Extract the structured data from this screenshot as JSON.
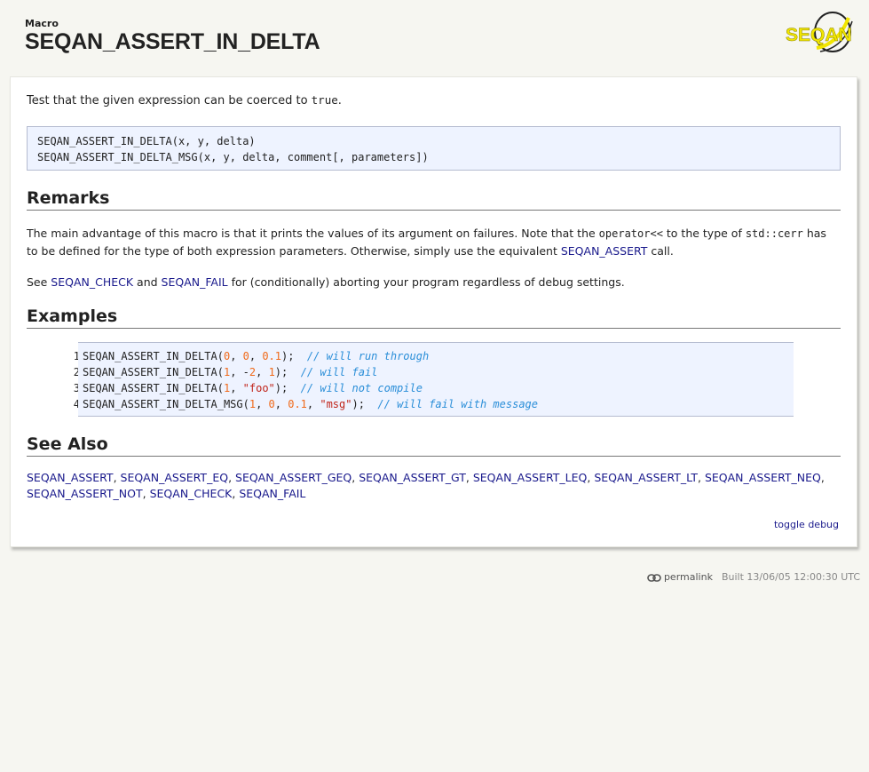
{
  "header": {
    "kind": "Macro",
    "title": "SEQAN_ASSERT_IN_DELTA",
    "logo_text": "SEQAN"
  },
  "summary": {
    "text_before": "Test that the given expression can be coerced to ",
    "code": "true",
    "text_after": "."
  },
  "signature": {
    "lines": [
      "SEQAN_ASSERT_IN_DELTA(x, y, delta)",
      "SEQAN_ASSERT_IN_DELTA_MSG(x, y, delta, comment[, parameters])"
    ]
  },
  "remarks": {
    "title": "Remarks",
    "p1_before": "The main advantage of this macro is that it prints the values of its argument on failures. Note that the ",
    "p1_code1": "operator<<",
    "p1_mid": " to the type of ",
    "p1_code2": "std::cerr",
    "p1_after": " has to be defined for the type of both expression parameters. Otherwise, simply use the equivalent ",
    "p1_link": "SEQAN_ASSERT",
    "p1_end": " call.",
    "p2_before": "See ",
    "p2_link1": "SEQAN_CHECK",
    "p2_mid": " and ",
    "p2_link2": "SEQAN_FAIL",
    "p2_after": " for (conditionally) aborting your program regardless of debug settings."
  },
  "examples": {
    "title": "Examples",
    "line_numbers": [
      "1",
      "2",
      "3",
      "4"
    ],
    "lines": [
      [
        {
          "t": "SEQAN_ASSERT_IN_DELTA(",
          "k": "plain"
        },
        {
          "t": "0",
          "k": "num"
        },
        {
          "t": ", ",
          "k": "plain"
        },
        {
          "t": "0",
          "k": "num"
        },
        {
          "t": ", ",
          "k": "plain"
        },
        {
          "t": "0.1",
          "k": "num"
        },
        {
          "t": ");  ",
          "k": "plain"
        },
        {
          "t": "// will run through",
          "k": "cmt"
        }
      ],
      [
        {
          "t": "SEQAN_ASSERT_IN_DELTA(",
          "k": "plain"
        },
        {
          "t": "1",
          "k": "num"
        },
        {
          "t": ", -",
          "k": "plain"
        },
        {
          "t": "2",
          "k": "num"
        },
        {
          "t": ", ",
          "k": "plain"
        },
        {
          "t": "1",
          "k": "num"
        },
        {
          "t": ");  ",
          "k": "plain"
        },
        {
          "t": "// will fail",
          "k": "cmt"
        }
      ],
      [
        {
          "t": "SEQAN_ASSERT_IN_DELTA(",
          "k": "plain"
        },
        {
          "t": "1",
          "k": "num"
        },
        {
          "t": ", ",
          "k": "plain"
        },
        {
          "t": "\"foo\"",
          "k": "str"
        },
        {
          "t": ");  ",
          "k": "plain"
        },
        {
          "t": "// will not compile",
          "k": "cmt"
        }
      ],
      [
        {
          "t": "SEQAN_ASSERT_IN_DELTA_MSG(",
          "k": "plain"
        },
        {
          "t": "1",
          "k": "num"
        },
        {
          "t": ", ",
          "k": "plain"
        },
        {
          "t": "0",
          "k": "num"
        },
        {
          "t": ", ",
          "k": "plain"
        },
        {
          "t": "0.1",
          "k": "num"
        },
        {
          "t": ", ",
          "k": "plain"
        },
        {
          "t": "\"msg\"",
          "k": "str"
        },
        {
          "t": ");  ",
          "k": "plain"
        },
        {
          "t": "// will fail with message",
          "k": "cmt"
        }
      ]
    ]
  },
  "see_also": {
    "title": "See Also",
    "links": [
      "SEQAN_ASSERT",
      "SEQAN_ASSERT_EQ",
      "SEQAN_ASSERT_GEQ",
      "SEQAN_ASSERT_GT",
      "SEQAN_ASSERT_LEQ",
      "SEQAN_ASSERT_LT",
      "SEQAN_ASSERT_NEQ",
      "SEQAN_ASSERT_NOT",
      "SEQAN_CHECK",
      "SEQAN_FAIL"
    ]
  },
  "toggle_debug": "toggle debug",
  "footer": {
    "permalink": "permalink",
    "permalink_icon": "link-icon",
    "built": "Built 13/06/05 12:00:30 UTC"
  },
  "colors": {
    "link": "#1a1a8c",
    "code_bg": "#eef3ff",
    "number": "#f06a1a",
    "string": "#c0241a",
    "comment": "#2a8ed8",
    "logo_yellow": "#f2e600"
  }
}
